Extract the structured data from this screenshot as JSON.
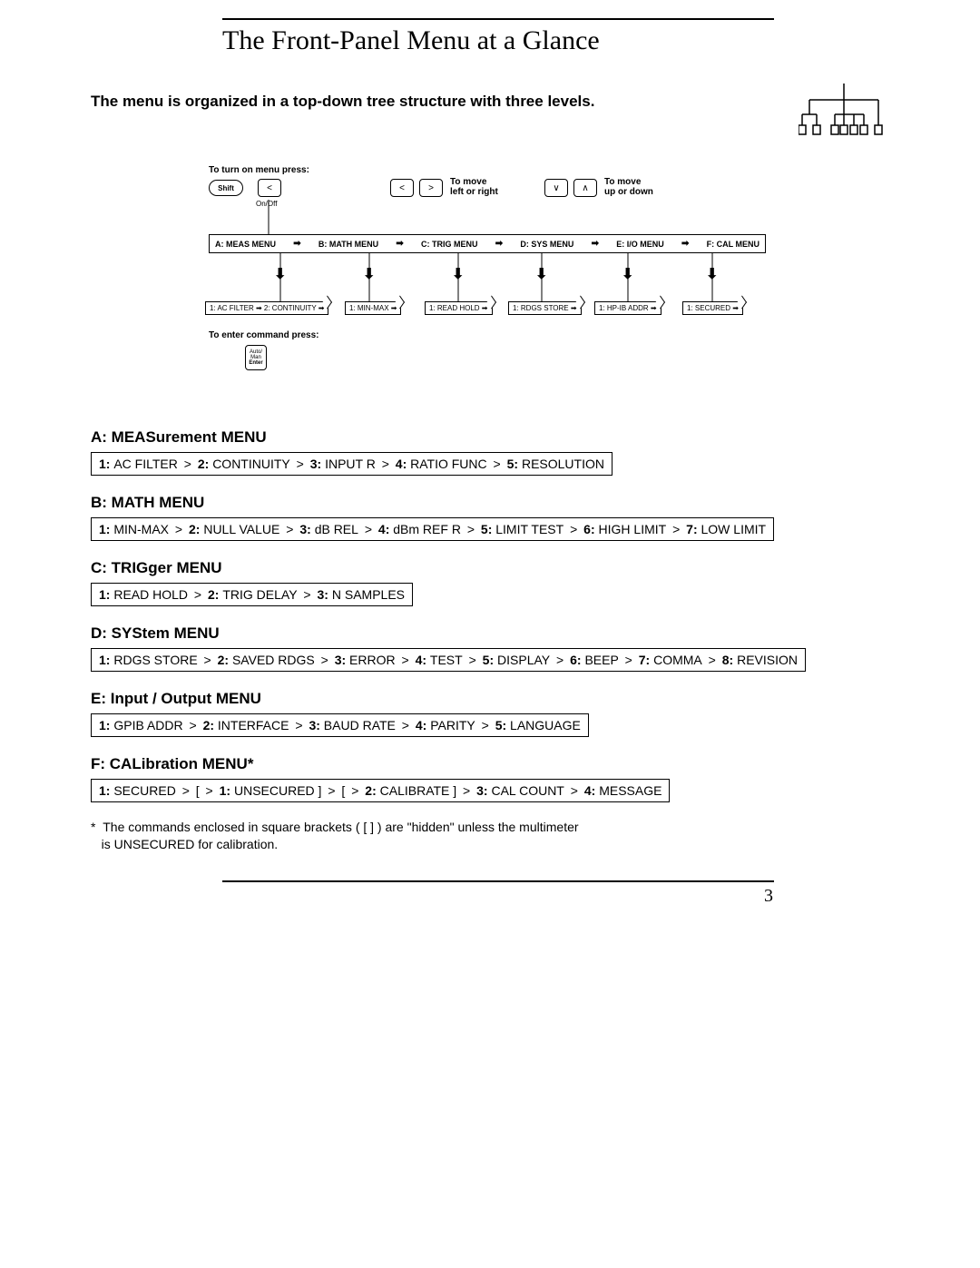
{
  "title": "The Front-Panel Menu at a Glance",
  "subhead": "The menu is organized in a top-down tree structure with three levels.",
  "diagram": {
    "turn_on_label": "To turn on menu press:",
    "shift_key": "Shift",
    "onoff_label": "On/Off",
    "move_lr": "To move\nleft or right",
    "move_ud": "To move\nup or down",
    "menubar": [
      "A: MEAS MENU",
      "B: MATH MENU",
      "C: TRIG MENU",
      "D: SYS MENU",
      "E: I/O MENU",
      "F: CAL MENU"
    ],
    "leaves": [
      "1: AC FILTER ➡ 2: CONTINUITY ➡",
      "1: MIN-MAX ➡",
      "1: READ HOLD ➡",
      "1: RDGS STORE ➡",
      "1: HP-IB ADDR ➡",
      "1: SECURED ➡"
    ],
    "enter_label": "To enter command press:",
    "enter_key_top": "Auto/",
    "enter_key_mid": "Man",
    "enter_key_bot": "Enter"
  },
  "sections": [
    {
      "heading": "A: MEASurement MENU",
      "items": [
        {
          "n": "1:",
          "t": "AC FILTER"
        },
        {
          "n": "2:",
          "t": "CONTINUITY"
        },
        {
          "n": "3:",
          "t": "INPUT R"
        },
        {
          "n": "4:",
          "t": "RATIO FUNC"
        },
        {
          "n": "5:",
          "t": "RESOLUTION"
        }
      ]
    },
    {
      "heading": "B: MATH MENU",
      "items": [
        {
          "n": "1:",
          "t": "MIN-MAX"
        },
        {
          "n": "2:",
          "t": "NULL VALUE"
        },
        {
          "n": "3:",
          "t": "dB REL"
        },
        {
          "n": "4:",
          "t": "dBm REF R"
        },
        {
          "n": "5:",
          "t": "LIMIT TEST"
        },
        {
          "n": "6:",
          "t": "HIGH LIMIT"
        },
        {
          "n": "7:",
          "t": "LOW LIMIT"
        }
      ]
    },
    {
      "heading": "C: TRIGger MENU",
      "items": [
        {
          "n": "1:",
          "t": "READ HOLD"
        },
        {
          "n": "2:",
          "t": "TRIG DELAY"
        },
        {
          "n": "3:",
          "t": "N SAMPLES"
        }
      ]
    },
    {
      "heading": "D: SYStem MENU",
      "items": [
        {
          "n": "1:",
          "t": "RDGS STORE"
        },
        {
          "n": "2:",
          "t": "SAVED RDGS"
        },
        {
          "n": "3:",
          "t": "ERROR"
        },
        {
          "n": "4:",
          "t": "TEST"
        },
        {
          "n": "5:",
          "t": "DISPLAY"
        },
        {
          "n": "6:",
          "t": "BEEP"
        },
        {
          "n": "7:",
          "t": "COMMA"
        },
        {
          "n": "8:",
          "t": "REVISION"
        }
      ]
    },
    {
      "heading": "E: Input / Output MENU",
      "items": [
        {
          "n": "1:",
          "t": "GPIB ADDR"
        },
        {
          "n": "2:",
          "t": "INTERFACE"
        },
        {
          "n": "3:",
          "t": "BAUD RATE"
        },
        {
          "n": "4:",
          "t": "PARITY"
        },
        {
          "n": "5:",
          "t": "LANGUAGE"
        }
      ]
    },
    {
      "heading": "F: CALibration MENU*",
      "items": [
        {
          "n": "1:",
          "t": "SECURED"
        },
        {
          "n": "",
          "t": "[",
          "raw": true
        },
        {
          "n": "1:",
          "t": "UNSECURED ]"
        },
        {
          "n": "",
          "t": "[",
          "raw": true
        },
        {
          "n": "2:",
          "t": "CALIBRATE ]"
        },
        {
          "n": "3:",
          "t": "CAL COUNT"
        },
        {
          "n": "4:",
          "t": "MESSAGE"
        }
      ]
    }
  ],
  "footnote_prefix": "*",
  "footnote_line1": "The commands enclosed in square brackets ( [ ] ) are \"hidden\" unless the multimeter",
  "footnote_line2": "is UNSECURED for calibration.",
  "page_number": "3"
}
